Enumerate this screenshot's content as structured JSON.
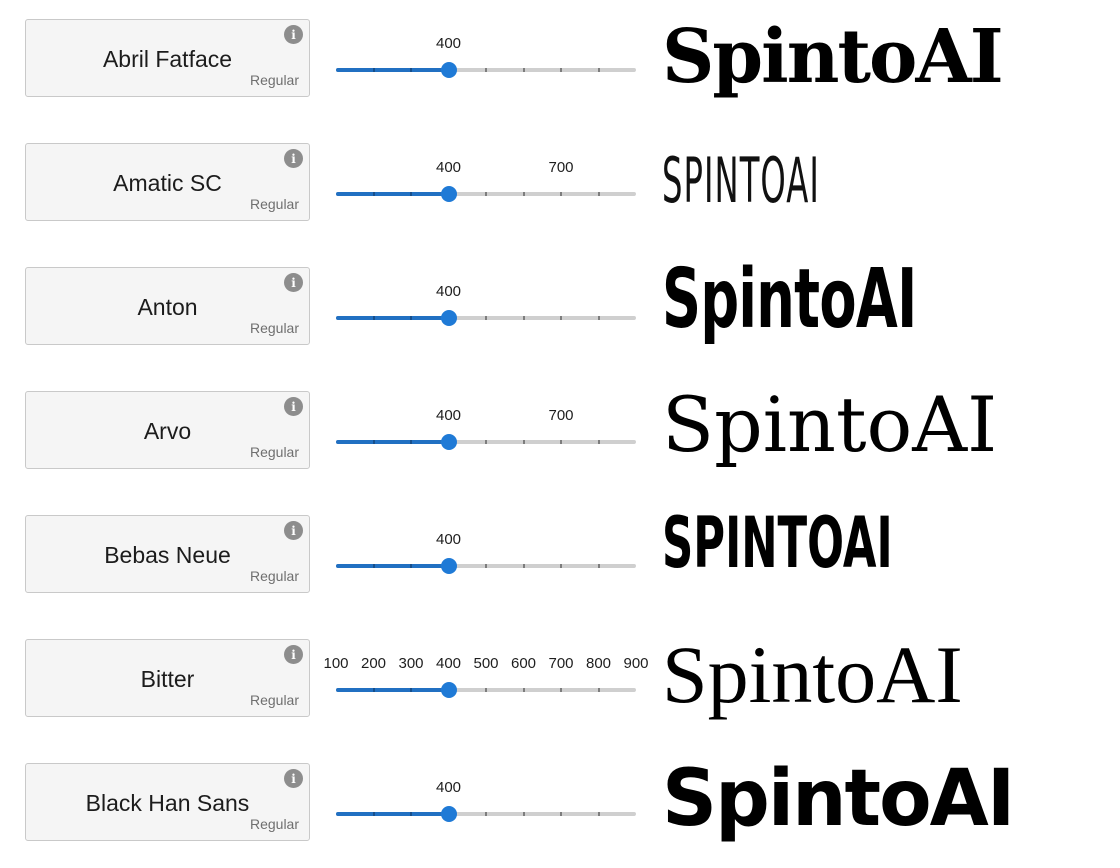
{
  "sample_text": "SpintoAI",
  "accent_color": "#1f7ad6",
  "track_color": "#cfcfcf",
  "icons": {
    "info": "info-icon"
  },
  "fonts": [
    {
      "name": "Abril Fatface",
      "style": "Regular",
      "weights": [
        400
      ],
      "labeled_weights": [
        "400"
      ],
      "selected_weight": 400,
      "preview": "SpintoAI"
    },
    {
      "name": "Amatic SC",
      "style": "Regular",
      "weights": [
        400,
        700
      ],
      "labeled_weights": [
        "400",
        "700"
      ],
      "selected_weight": 400,
      "preview": "SPINTOAI"
    },
    {
      "name": "Anton",
      "style": "Regular",
      "weights": [
        400
      ],
      "labeled_weights": [
        "400"
      ],
      "selected_weight": 400,
      "preview": "SpintoAI"
    },
    {
      "name": "Arvo",
      "style": "Regular",
      "weights": [
        400,
        700
      ],
      "labeled_weights": [
        "400",
        "700"
      ],
      "selected_weight": 400,
      "preview": "SpintoAI"
    },
    {
      "name": "Bebas Neue",
      "style": "Regular",
      "weights": [
        400
      ],
      "labeled_weights": [
        "400"
      ],
      "selected_weight": 400,
      "preview": "SPINTOAI"
    },
    {
      "name": "Bitter",
      "style": "Regular",
      "weights": [
        100,
        200,
        300,
        400,
        500,
        600,
        700,
        800,
        900
      ],
      "labeled_weights": [
        "100",
        "200",
        "300",
        "400",
        "500",
        "600",
        "700",
        "800",
        "900"
      ],
      "selected_weight": 400,
      "preview": "SpintoAI"
    },
    {
      "name": "Black Han Sans",
      "style": "Regular",
      "weights": [
        400
      ],
      "labeled_weights": [
        "400"
      ],
      "selected_weight": 400,
      "preview": "SpintoAI"
    }
  ]
}
